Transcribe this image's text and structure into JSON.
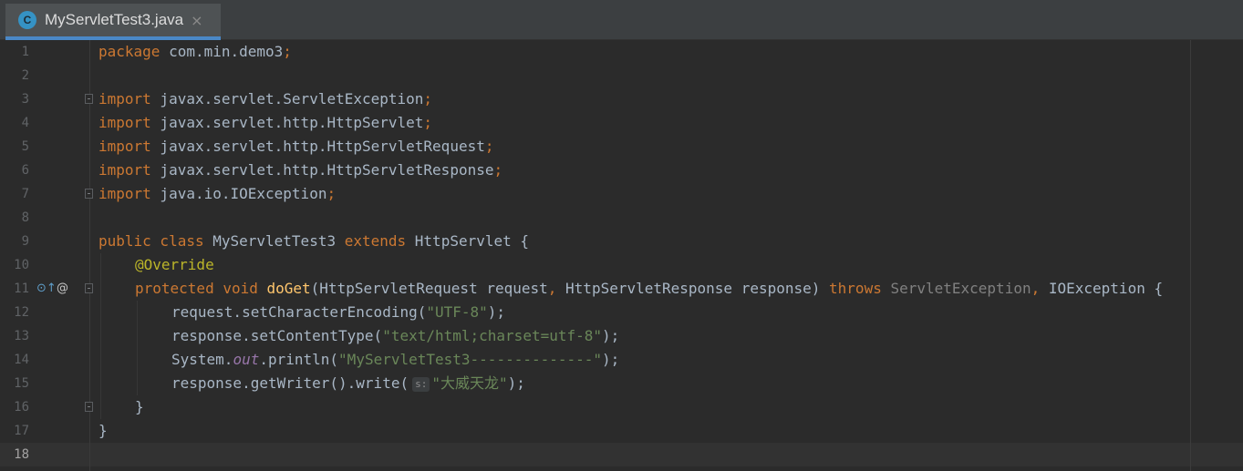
{
  "tab": {
    "icon_letter": "C",
    "label": "MyServletTest3.java",
    "close": "×"
  },
  "lines": [
    {
      "num": "1"
    },
    {
      "num": "2"
    },
    {
      "num": "3"
    },
    {
      "num": "4"
    },
    {
      "num": "5"
    },
    {
      "num": "6"
    },
    {
      "num": "7"
    },
    {
      "num": "8"
    },
    {
      "num": "9"
    },
    {
      "num": "10"
    },
    {
      "num": "11"
    },
    {
      "num": "12"
    },
    {
      "num": "13"
    },
    {
      "num": "14"
    },
    {
      "num": "15"
    },
    {
      "num": "16"
    },
    {
      "num": "17"
    },
    {
      "num": "18"
    }
  ],
  "code": {
    "l1_kw": "package",
    "l1_rest": " com.min.demo3",
    "import_kw": "import",
    "l3": " javax.servlet.ServletException",
    "l4": " javax.servlet.http.HttpServlet",
    "l5": " javax.servlet.http.HttpServletRequest",
    "l6": " javax.servlet.http.HttpServletResponse",
    "l7": " java.io.IOException",
    "semi": ";",
    "l9_kw": "public class",
    "l9_name": " MyServletTest3 ",
    "l9_ext": "extends",
    "l9_rest": " HttpServlet {",
    "l10_ann": "@Override",
    "l11_kw": "protected void",
    "l11_fn": "doGet",
    "l11_params": "(HttpServletRequest request",
    "l11_comma": ",",
    "l11_params2": " HttpServletResponse response) ",
    "l11_throws": "throws",
    "l11_ex1": " ServletException",
    "l11_comma2": ",",
    "l11_ex2": " IOException {",
    "l12_a": "request.setCharacterEncoding(",
    "l12_str": "\"UTF-8\"",
    "l12_b": ");",
    "l13_a": "response.setContentType(",
    "l13_str": "\"text/html;charset=utf-8\"",
    "l13_b": ");",
    "l14_a": "System.",
    "l14_field": "out",
    "l14_b": ".println(",
    "l14_str": "\"MyServletTest3--------------\"",
    "l14_c": ");",
    "l15_a": "response.getWriter().write(",
    "l15_hint": "s:",
    "l15_str": "\"大威天龙\"",
    "l15_b": ");",
    "l16": "}",
    "l17": "}"
  },
  "gutter_icons": {
    "override_icon": "⊙↑",
    "annotation_icon": "@"
  },
  "colors": {
    "keyword": "#cc7832",
    "string": "#6a8759",
    "method": "#ffc66d",
    "annotation": "#bbb529",
    "text": "#a9b7c6",
    "field": "#9876aa",
    "tab_accent": "#4a88c7"
  }
}
